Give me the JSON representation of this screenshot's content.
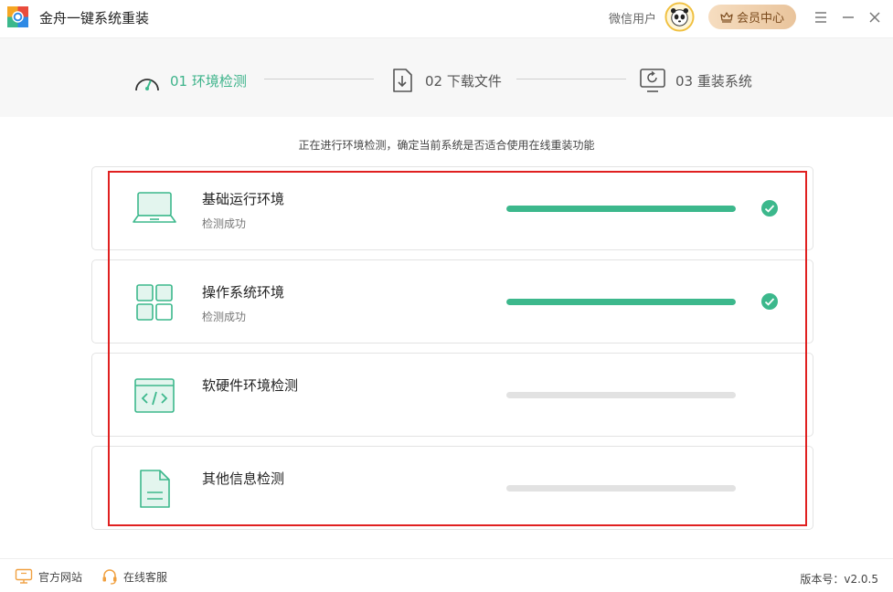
{
  "app": {
    "title": "金舟一键系统重装"
  },
  "header": {
    "user_name": "微信用户",
    "vip_label": "会员中心"
  },
  "colors": {
    "accent": "#3cb88c",
    "highlight": "#e02020",
    "vip": "#7a4a1c"
  },
  "steps": [
    {
      "label": "01 环境检测",
      "icon": "gauge-icon",
      "state": "active"
    },
    {
      "label": "02 下载文件",
      "icon": "download-file-icon",
      "state": "inactive"
    },
    {
      "label": "03 重装系统",
      "icon": "reinstall-monitor-icon",
      "state": "inactive"
    }
  ],
  "subtitle": "正在进行环境检测，确定当前系统是否适合使用在线重装功能",
  "checks": [
    {
      "title": "基础运行环境",
      "status": "检测成功",
      "progress": 1.0,
      "done": true,
      "icon": "laptop-icon"
    },
    {
      "title": "操作系统环境",
      "status": "检测成功",
      "progress": 1.0,
      "done": true,
      "icon": "windows-grid-icon"
    },
    {
      "title": "软硬件环境检测",
      "status": "",
      "progress": 0.0,
      "done": false,
      "icon": "code-window-icon"
    },
    {
      "title": "其他信息检测",
      "status": "",
      "progress": 0.0,
      "done": false,
      "icon": "document-icon"
    }
  ],
  "footer": {
    "website_label": "官方网站",
    "support_label": "在线客服",
    "version_label": "版本号：v2.0.5"
  }
}
